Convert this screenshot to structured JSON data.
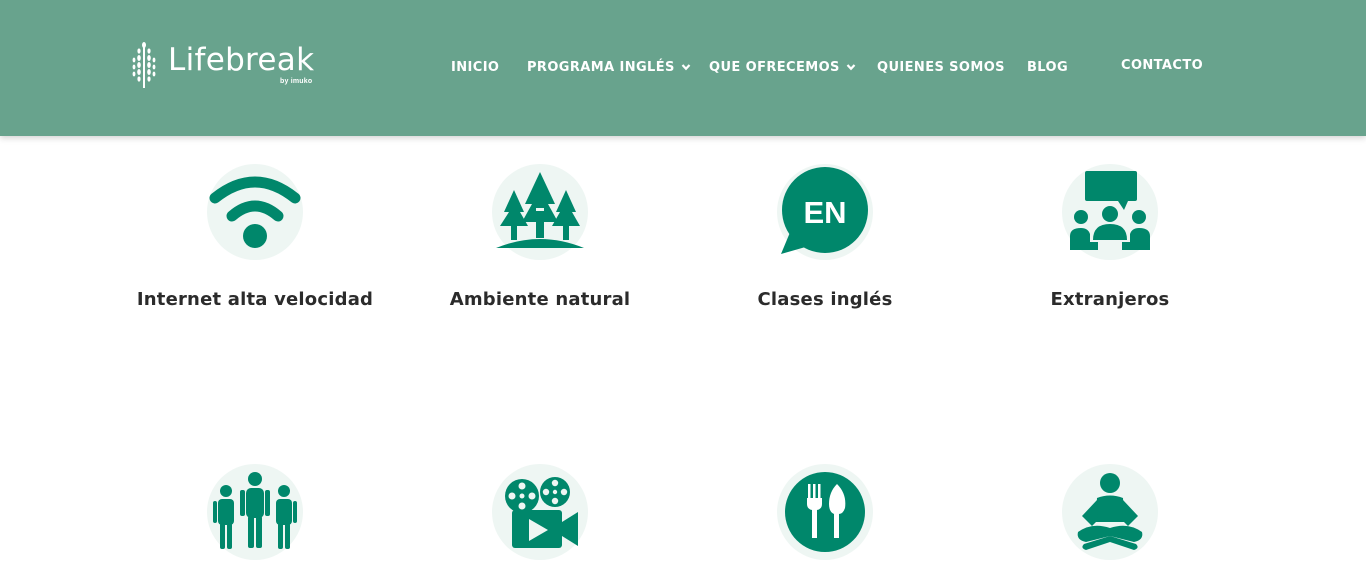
{
  "brand": {
    "name": "Lifebreak",
    "by": "by imuko"
  },
  "colors": {
    "header_bg": "#68a38d",
    "icon_green": "#00876b",
    "icon_bg": "#eef6f3",
    "label_text": "#2b2b2b"
  },
  "nav": {
    "items": [
      {
        "label": "INICIO",
        "dropdown": false
      },
      {
        "label": "PROGRAMA INGLÉS",
        "dropdown": true
      },
      {
        "label": "QUE OFRECEMOS",
        "dropdown": true
      },
      {
        "label": "QUIENES SOMOS",
        "dropdown": false
      },
      {
        "label": "BLOG",
        "dropdown": false
      },
      {
        "label": "CONTACTO",
        "dropdown": false
      }
    ]
  },
  "features": [
    {
      "label": "Internet alta velocidad",
      "icon": "wifi-icon"
    },
    {
      "label": "Ambiente natural",
      "icon": "trees-icon"
    },
    {
      "label": "Clases inglés",
      "icon": "english-speech-bubble-icon",
      "icon_text": "EN"
    },
    {
      "label": "Extranjeros",
      "icon": "group-chat-icon"
    },
    {
      "label": "",
      "icon": "hikers-icon"
    },
    {
      "label": "",
      "icon": "film-camera-icon"
    },
    {
      "label": "",
      "icon": "restaurant-icon"
    },
    {
      "label": "",
      "icon": "meditation-icon"
    }
  ]
}
